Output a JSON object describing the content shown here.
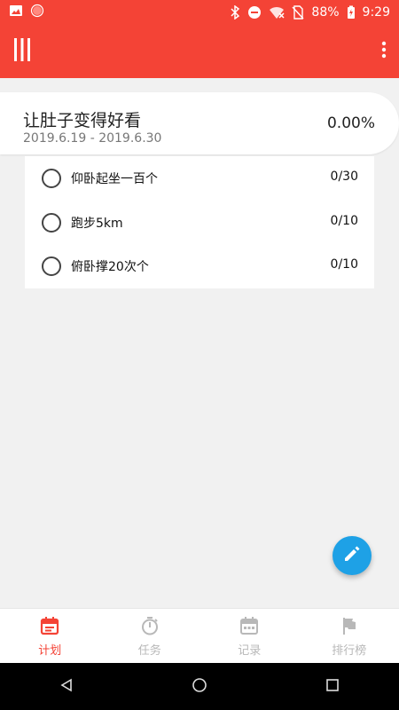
{
  "status_bar": {
    "battery": "88%",
    "time": "9:29",
    "icons": [
      "image-icon",
      "circle-icon",
      "bluetooth-icon",
      "do-not-disturb-icon",
      "wifi-icon",
      "no-sim-icon",
      "battery-charging-icon"
    ]
  },
  "toolbar": {
    "menu_icon": "menu-icon",
    "more_icon": "more-vert-icon"
  },
  "plan": {
    "title": "让肚子变得好看",
    "dates": "2019.6.19 - 2019.6.30",
    "progress": "0.00%"
  },
  "tasks": [
    {
      "name": "仰卧起坐一百个",
      "count": "0/30"
    },
    {
      "name": "跑步5km",
      "count": "0/10"
    },
    {
      "name": "俯卧撑20次个",
      "count": "0/10"
    }
  ],
  "bottom_nav": [
    {
      "label": "计划",
      "icon": "calendar-icon",
      "active": true
    },
    {
      "label": "任务",
      "icon": "timer-icon",
      "active": false
    },
    {
      "label": "记录",
      "icon": "calendar-icon",
      "active": false
    },
    {
      "label": "排行榜",
      "icon": "flag-icon",
      "active": false
    }
  ],
  "colors": {
    "primary": "#f44336",
    "fab": "#1ea1e6",
    "inactive": "#b8b8b8"
  }
}
